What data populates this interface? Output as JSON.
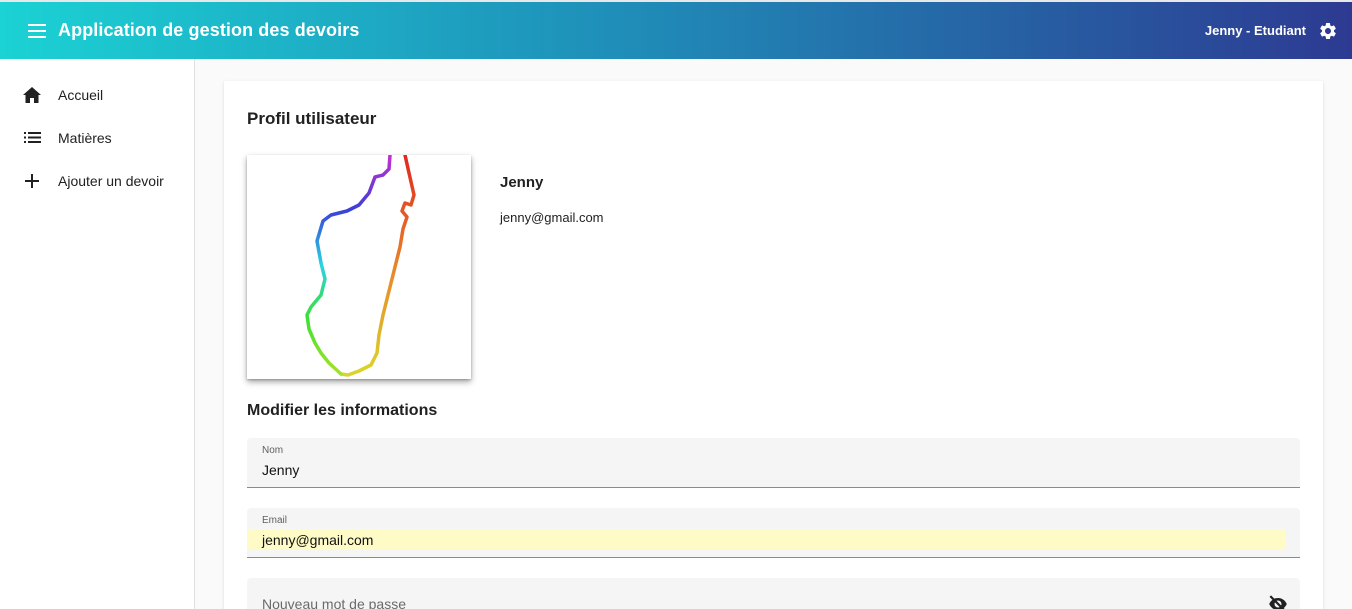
{
  "toolbar": {
    "menu_icon": "menu-icon",
    "title": "Application de gestion des devoirs",
    "user_label": "Jenny - Etudiant",
    "settings_icon": "gear-icon"
  },
  "sidenav": {
    "items": [
      {
        "label": "Accueil",
        "icon": "home-icon"
      },
      {
        "label": "Matières",
        "icon": "list-icon"
      },
      {
        "label": "Ajouter un devoir",
        "icon": "plus-icon"
      }
    ]
  },
  "profile": {
    "title": "Profil utilisateur",
    "name": "Jenny",
    "email": "jenny@gmail.com",
    "section_title": "Modifier les informations"
  },
  "form": {
    "nom": {
      "label": "Nom",
      "value": "Jenny"
    },
    "email": {
      "label": "Email",
      "value": "jenny@gmail.com"
    },
    "password": {
      "placeholder": "Nouveau mot de passe",
      "icon": "eye-off-icon"
    }
  },
  "colors": {
    "toolbar_start": "#1bd2d4",
    "toolbar_end": "#2d3a92",
    "autofill": "#fffbc7"
  }
}
